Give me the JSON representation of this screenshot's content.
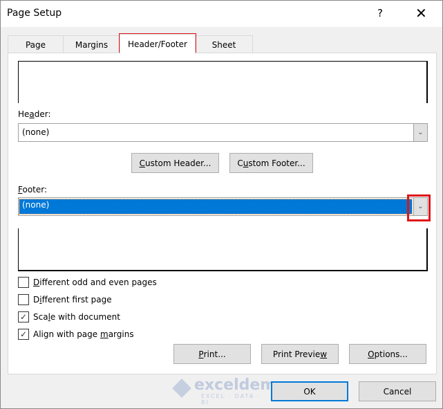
{
  "window": {
    "title": "Page Setup",
    "help_label": "?",
    "close_label": "✕"
  },
  "tabs": [
    {
      "label": "Page",
      "active": false
    },
    {
      "label": "Margins",
      "active": false
    },
    {
      "label": "Header/Footer",
      "active": true
    },
    {
      "label": "Sheet",
      "active": false
    }
  ],
  "header": {
    "label_pre": "He",
    "label_ul": "a",
    "label_post": "der:",
    "value": "(none)"
  },
  "footer": {
    "label_ul": "F",
    "label_post": "ooter:",
    "value": "(none)"
  },
  "custom_buttons": {
    "header": {
      "ul": "C",
      "rest": "ustom Header..."
    },
    "footer": {
      "pre": "C",
      "ul": "u",
      "rest": "stom Footer..."
    }
  },
  "checkboxes": [
    {
      "pre": "",
      "ul": "D",
      "post": "ifferent odd and even pages",
      "checked": false
    },
    {
      "pre": "D",
      "ul": "i",
      "post": "fferent first page",
      "checked": false
    },
    {
      "pre": "Sca",
      "ul": "l",
      "post": "e with document",
      "checked": true
    },
    {
      "pre": "Align with page ",
      "ul": "m",
      "post": "argins",
      "checked": true
    }
  ],
  "panel_buttons": {
    "print": {
      "ul": "P",
      "rest": "rint..."
    },
    "print_preview": {
      "pre": "Print Previe",
      "ul": "w"
    },
    "options": {
      "ul": "O",
      "rest": "ptions..."
    }
  },
  "footer_buttons": {
    "ok": "OK",
    "cancel": "Cancel"
  },
  "watermark": {
    "name": "exceldemy",
    "tagline": "EXCEL · DATA · BI"
  },
  "icons": {
    "dropdown": "chevron-down-icon",
    "check": "checkmark-icon"
  },
  "colors": {
    "accent": "#0078d7",
    "highlight": "#e0141a"
  }
}
